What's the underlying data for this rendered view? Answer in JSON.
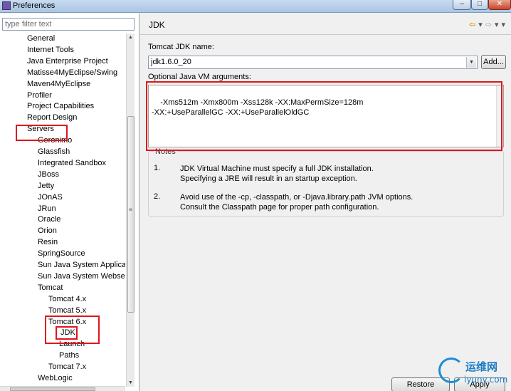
{
  "window": {
    "title": "Preferences",
    "controls": {
      "minimize": "–",
      "maximize": "□",
      "close": "✕"
    }
  },
  "filter": {
    "placeholder": "type filter text"
  },
  "tree": [
    {
      "label": "General",
      "indent": 1
    },
    {
      "label": "Internet Tools",
      "indent": 1
    },
    {
      "label": "Java Enterprise Project",
      "indent": 1
    },
    {
      "label": "Matisse4MyEclipse/Swing",
      "indent": 1
    },
    {
      "label": "Maven4MyEclipse",
      "indent": 1
    },
    {
      "label": "Profiler",
      "indent": 1
    },
    {
      "label": "Project Capabilities",
      "indent": 1
    },
    {
      "label": "Report Design",
      "indent": 1
    },
    {
      "label": "Servers",
      "indent": 1
    },
    {
      "label": "Geronimo",
      "indent": 2
    },
    {
      "label": "Glassfish",
      "indent": 2
    },
    {
      "label": "Integrated Sandbox",
      "indent": 2
    },
    {
      "label": "JBoss",
      "indent": 2
    },
    {
      "label": "Jetty",
      "indent": 2
    },
    {
      "label": "JOnAS",
      "indent": 2
    },
    {
      "label": "JRun",
      "indent": 2
    },
    {
      "label": "Oracle",
      "indent": 2
    },
    {
      "label": "Orion",
      "indent": 2
    },
    {
      "label": "Resin",
      "indent": 2
    },
    {
      "label": "SpringSource",
      "indent": 2
    },
    {
      "label": "Sun Java System Applicatio",
      "indent": 2
    },
    {
      "label": "Sun Java System Webserve",
      "indent": 2
    },
    {
      "label": "Tomcat",
      "indent": 2
    },
    {
      "label": "Tomcat  4.x",
      "indent": 3
    },
    {
      "label": "Tomcat  5.x",
      "indent": 3
    },
    {
      "label": "Tomcat  6.x",
      "indent": 3
    },
    {
      "label": "JDK",
      "indent": 4,
      "selected": true
    },
    {
      "label": "Launch",
      "indent": 4
    },
    {
      "label": "Paths",
      "indent": 4
    },
    {
      "label": "Tomcat  7.x",
      "indent": 3
    },
    {
      "label": "WebLogic",
      "indent": 2
    }
  ],
  "page": {
    "title": "JDK",
    "jdk_name_label": "Tomcat JDK name:",
    "jdk_name_value": "jdk1.6.0_20",
    "add_button": "Add...",
    "vm_args_label": "Optional Java VM arguments:",
    "vm_args_value": "-Xms512m -Xmx800m -Xss128k -XX:MaxPermSize=128m\n-XX:+UseParallelGC -XX:+UseParallelOldGC",
    "notes_title": "Notes",
    "notes": [
      {
        "num": "1.",
        "text": "JDK Virtual Machine must specify a full JDK installation.\nSpecifying a JRE will result in an startup exception."
      },
      {
        "num": "2.",
        "text": "Avoid use of the -cp, -classpath, or -Djava.library.path JVM options.\nConsult the Classpath page for proper path configuration."
      }
    ],
    "restore_defaults": "Restore Defaults",
    "apply": "Apply"
  },
  "nav": {
    "back": "⇦",
    "back_menu": "▾",
    "forward": "⇨",
    "forward_menu": "▾",
    "view_menu": "▾"
  },
  "watermark": {
    "cn": "运维网",
    "en": "iyunv.com"
  },
  "colors": {
    "annotation_red": "#e0151b",
    "selection": "#ffffff"
  }
}
